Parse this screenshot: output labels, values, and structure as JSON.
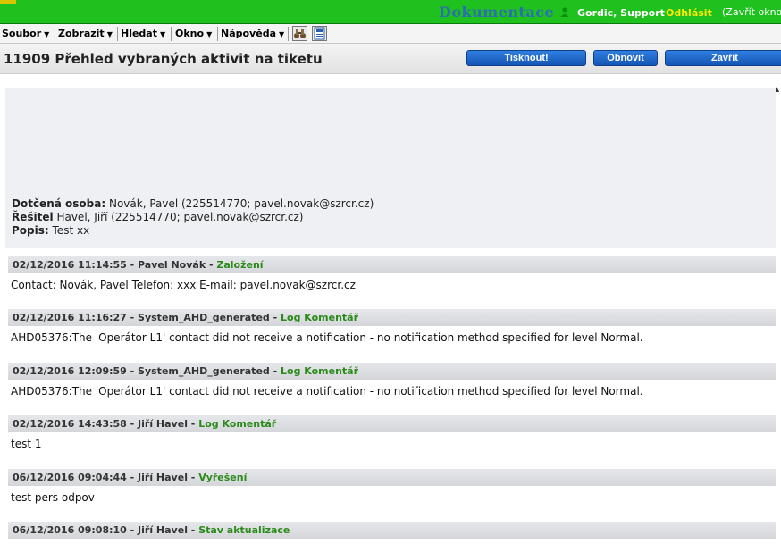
{
  "topbar": {
    "doc_link": "Dokumentace",
    "user_name": "Gordic, Support",
    "logout": "Odhlásit",
    "close_window": "(Zavřít okno"
  },
  "menu": {
    "items": [
      "Soubor",
      "Zobrazit",
      "Hledat",
      "Okno",
      "Nápověda"
    ]
  },
  "toolbar": {
    "icons": [
      "binoculars-icon",
      "document-icon"
    ]
  },
  "title": "11909 Přehled vybraných aktivit na tiketu",
  "buttons": {
    "print": "Tisknout!",
    "refresh": "Obnovit",
    "close": "Zavřít"
  },
  "info": {
    "affected_label": "Dotčená osoba:",
    "affected_value": "Novák, Pavel (225514770; pavel.novak@szrcr.cz)",
    "solver_label": "Řešitel",
    "solver_value": "Havel, Jiří (225514770; pavel.novak@szrcr.cz)",
    "desc_label": "Popis:",
    "desc_value": "Test xx"
  },
  "log": [
    {
      "meta": "02/12/2016 11:14:55 - Pavel Novák - ",
      "action": "Založení",
      "body": "Contact: Novák, Pavel Telefon: xxx E-mail: pavel.novak@szrcr.cz"
    },
    {
      "meta": "02/12/2016 11:16:27 - System_AHD_generated - ",
      "action": "Log Komentář",
      "body": "AHD05376:The 'Operátor L1' contact did not receive a notification - no notification method specified for level Normal."
    },
    {
      "meta": "02/12/2016 12:09:59 - System_AHD_generated - ",
      "action": "Log Komentář",
      "body": "AHD05376:The 'Operátor L1' contact did not receive a notification - no notification method specified for level Normal."
    },
    {
      "meta": "02/12/2016 14:43:58 - Jiří Havel - ",
      "action": "Log Komentář",
      "body": "test 1"
    },
    {
      "meta": "06/12/2016 09:04:44 - Jiří Havel - ",
      "action": "Vyřešení",
      "body": "test pers odpov"
    },
    {
      "meta": "06/12/2016 09:08:10 - Jiří Havel - ",
      "action": "Stav aktualizace",
      "body": ""
    }
  ]
}
